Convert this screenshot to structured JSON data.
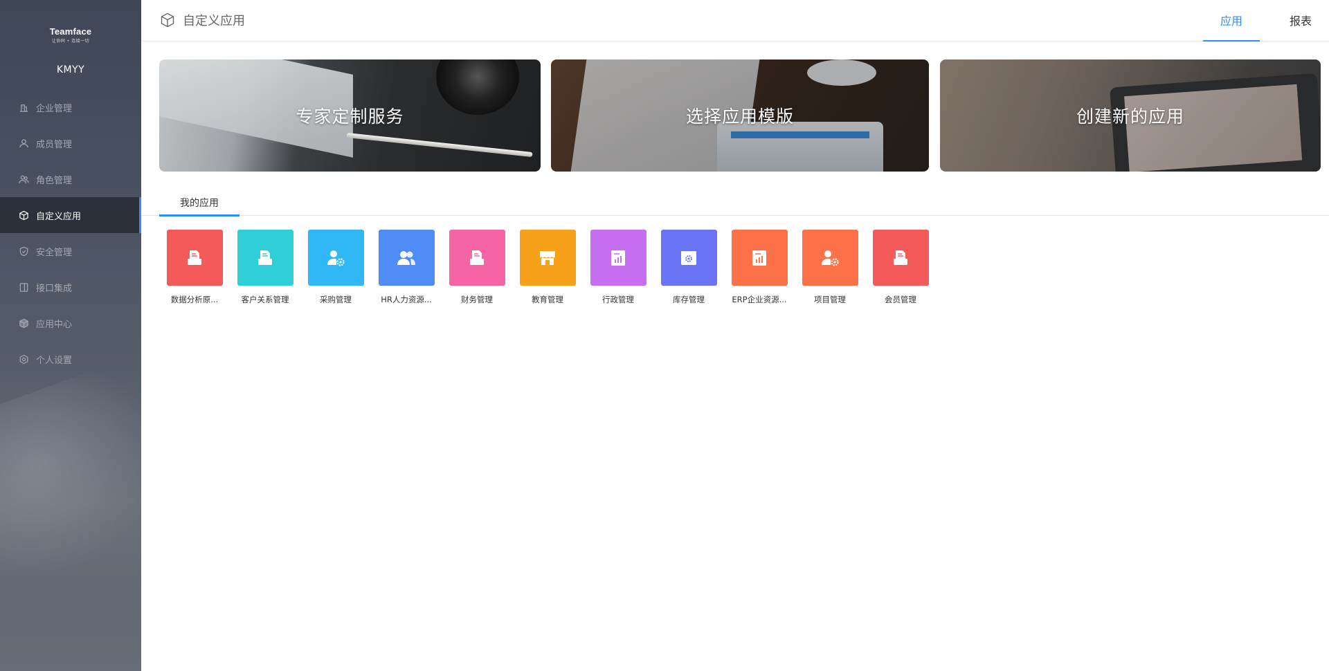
{
  "sidebar": {
    "logo_title": "Teamface",
    "logo_subtitle": "让协同 • 连接一切",
    "company": "KMYY",
    "items": [
      {
        "label": "企业管理",
        "icon": "building-icon",
        "active": false
      },
      {
        "label": "成员管理",
        "icon": "user-icon",
        "active": false
      },
      {
        "label": "角色管理",
        "icon": "users-icon",
        "active": false
      },
      {
        "label": "自定义应用",
        "icon": "cube-icon",
        "active": true
      },
      {
        "label": "安全管理",
        "icon": "shield-icon",
        "active": false
      },
      {
        "label": "接口集成",
        "icon": "interface-icon",
        "active": false
      },
      {
        "label": "应用中心",
        "icon": "package-icon",
        "active": false
      },
      {
        "label": "个人设置",
        "icon": "settings-icon",
        "active": false
      }
    ]
  },
  "header": {
    "title": "自定义应用",
    "title_icon": "cube-icon",
    "tabs": [
      {
        "label": "应用",
        "active": true
      },
      {
        "label": "报表",
        "active": false
      }
    ]
  },
  "banners": [
    {
      "label": "专家定制服务"
    },
    {
      "label": "选择应用模版"
    },
    {
      "label": "创建新的应用"
    }
  ],
  "section": {
    "tab_label": "我的应用"
  },
  "apps": [
    {
      "label": "数据分析原...",
      "color": "#f55a5a",
      "icon": "document-icon"
    },
    {
      "label": "客户关系管理",
      "color": "#2ecfd6",
      "icon": "document-icon"
    },
    {
      "label": "采购管理",
      "color": "#2fb8f5",
      "icon": "user-gear-icon"
    },
    {
      "label": "HR人力资源...",
      "color": "#4f8cf5",
      "icon": "users-icon"
    },
    {
      "label": "财务管理",
      "color": "#f565a5",
      "icon": "document-icon"
    },
    {
      "label": "教育管理",
      "color": "#f7a11a",
      "icon": "store-icon"
    },
    {
      "label": "行政管理",
      "color": "#c86ef0",
      "icon": "report-icon"
    },
    {
      "label": "库存管理",
      "color": "#6b74f5",
      "icon": "box-gear-icon"
    },
    {
      "label": "ERP企业资源...",
      "color": "#fc7147",
      "icon": "report-icon"
    },
    {
      "label": "项目管理",
      "color": "#fc7147",
      "icon": "user-gear-icon"
    },
    {
      "label": "会员管理",
      "color": "#f55a5a",
      "icon": "document-icon"
    }
  ]
}
